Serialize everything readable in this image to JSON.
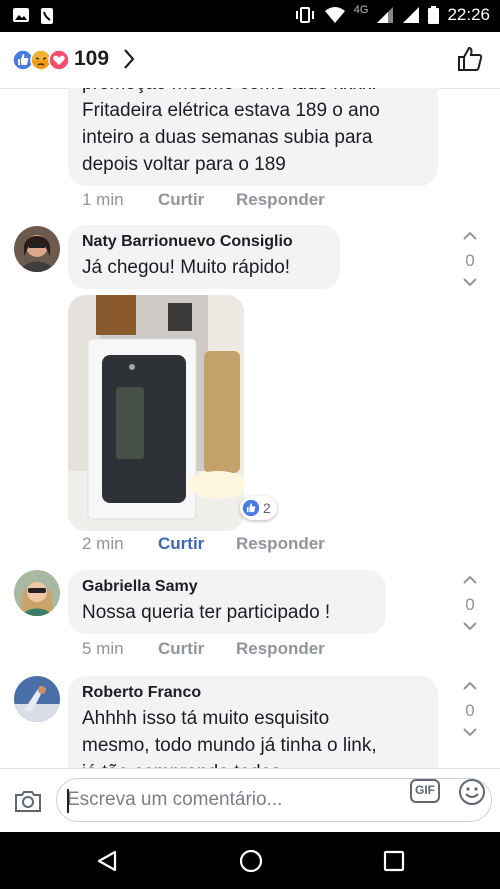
{
  "status_bar": {
    "network": "4G",
    "time": "22:26"
  },
  "reactions_bar": {
    "count": "109",
    "icons": [
      "like-icon",
      "angry-icon",
      "love-icon"
    ]
  },
  "comments": [
    {
      "text_lines": [
        "promoção mesmo como tudo kkkk.",
        "Fritadeira elétrica estava 189 o ano",
        "inteiro a duas semanas subia para",
        "depois voltar para o 189"
      ],
      "time": "1 min",
      "like_label": "Curtir",
      "reply_label": "Responder"
    },
    {
      "author": "Naty Barrionuevo Consiglio",
      "text": "Já chegou! Muito rápido!",
      "votes": "0",
      "photo_reactions": "2",
      "time": "2 min",
      "like_label": "Curtir",
      "reply_label": "Responder",
      "liked": true
    },
    {
      "author": "Gabriella Samy",
      "text": "Nossa queria ter participado !",
      "votes": "0",
      "time": "5 min",
      "like_label": "Curtir",
      "reply_label": "Responder"
    },
    {
      "author": "Roberto Franco",
      "text_lines": [
        "Ahhhh isso tá muito esquisito",
        "mesmo, todo mundo já tinha o link,",
        "já tão comprando todos..."
      ],
      "votes": "0"
    }
  ],
  "composer": {
    "placeholder": "Escreva um comentário...",
    "gif_label": "GIF"
  },
  "colors": {
    "accent": "#4267b2",
    "bubble": "#f2f3f5",
    "meta_text": "#90949c"
  }
}
